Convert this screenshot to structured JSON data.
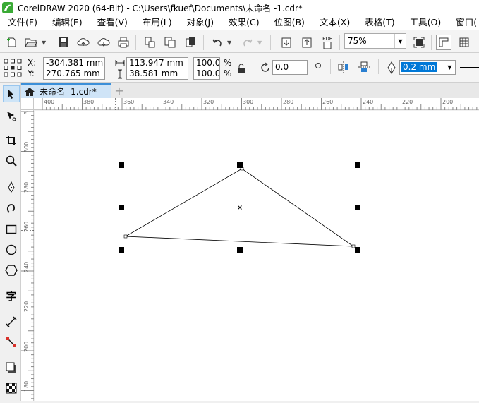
{
  "window": {
    "title": "CorelDRAW 2020 (64-Bit) - C:\\Users\\fkuef\\Documents\\未命名 -1.cdr*"
  },
  "menu": [
    {
      "label": "文件(F)"
    },
    {
      "label": "编辑(E)"
    },
    {
      "label": "查看(V)"
    },
    {
      "label": "布局(L)"
    },
    {
      "label": "对象(J)"
    },
    {
      "label": "效果(C)"
    },
    {
      "label": "位图(B)"
    },
    {
      "label": "文本(X)"
    },
    {
      "label": "表格(T)"
    },
    {
      "label": "工具(O)"
    },
    {
      "label": "窗口("
    }
  ],
  "toolbar": {
    "zoom_value": "75%",
    "pdf_label": "PDF"
  },
  "property_bar": {
    "x_label": "X:",
    "y_label": "Y:",
    "x_value": "-304.381 mm",
    "y_value": "270.765 mm",
    "width_value": "113.947 mm",
    "height_value": "38.581 mm",
    "scale_w": "100.0",
    "scale_h": "100.0",
    "percent": "%",
    "rotation": "0.0",
    "outline_width": "0.2 mm"
  },
  "document_tab": {
    "label": "未命名 -1.cdr*"
  },
  "ruler": {
    "horizontal_ticks": [
      "400",
      "380",
      "360",
      "340",
      "320",
      "300",
      "280",
      "260",
      "240",
      "220",
      "200"
    ],
    "vertical_ticks": [
      "3",
      "300",
      "280",
      "260",
      "240",
      "220",
      "200",
      "180"
    ]
  },
  "colors": {
    "accent": "#3c8fd8",
    "tab_bg": "#cfe4f7",
    "logo_green": "#3aaa35"
  }
}
